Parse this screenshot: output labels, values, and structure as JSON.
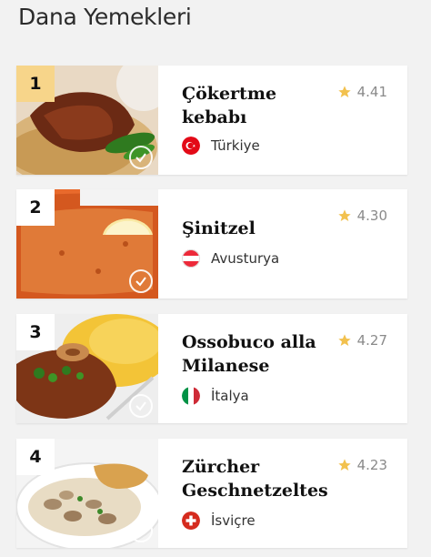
{
  "page_title": "Dana Yemekleri",
  "items": [
    {
      "rank": "1",
      "name": "Çökertme kebabı",
      "rating": "4.41",
      "country": "Türkiye",
      "flag": "turkey-flag-icon"
    },
    {
      "rank": "2",
      "name": "Şinitzel",
      "rating": "4.30",
      "country": "Avusturya",
      "flag": "austria-flag-icon"
    },
    {
      "rank": "3",
      "name": "Ossobuco alla Milanese",
      "rating": "4.27",
      "country": "İtalya",
      "flag": "italy-flag-icon"
    },
    {
      "rank": "4",
      "name": "Zürcher Geschnetzeltes",
      "rating": "4.23",
      "country": "İsviçre",
      "flag": "switzerland-flag-icon"
    }
  ],
  "colors": {
    "star": "#f2c14e",
    "rank_highlight": "#f7d58a",
    "background": "#f2f2f2"
  }
}
